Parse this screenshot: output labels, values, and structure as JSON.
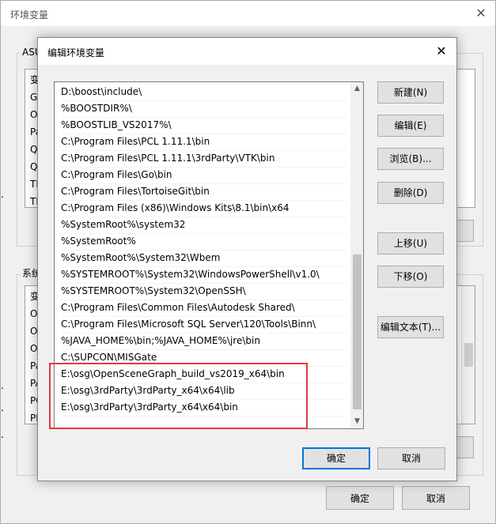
{
  "parent_window": {
    "title": "环境变量",
    "close_glyph": "✕",
    "user_group_label": "ASU",
    "system_group_label": "系统",
    "user_list_rows": [
      "变",
      "G",
      "O",
      "Pa",
      "Q",
      "Q",
      "TE",
      "TM"
    ],
    "system_list_rows": [
      "变",
      "O",
      "O",
      "O",
      "Pa",
      "PA",
      "PC",
      "PF"
    ],
    "ok_label": "确定",
    "cancel_label": "取消",
    "left_edge_fragments": [
      ".",
      ".",
      ".",
      "."
    ]
  },
  "dialog": {
    "title": "编辑环境变量",
    "close_glyph": "✕",
    "path_entries": [
      "D:\\boost\\include\\",
      "%BOOSTDIR%\\",
      "%BOOSTLIB_VS2017%\\",
      "C:\\Program Files\\PCL 1.11.1\\bin",
      "C:\\Program Files\\PCL 1.11.1\\3rdParty\\VTK\\bin",
      "C:\\Program Files\\Go\\bin",
      "C:\\Program Files\\TortoiseGit\\bin",
      "C:\\Program Files (x86)\\Windows Kits\\8.1\\bin\\x64",
      "%SystemRoot%\\system32",
      "%SystemRoot%",
      "%SystemRoot%\\System32\\Wbem",
      "%SYSTEMROOT%\\System32\\WindowsPowerShell\\v1.0\\",
      "%SYSTEMROOT%\\System32\\OpenSSH\\",
      "C:\\Program Files\\Common Files\\Autodesk Shared\\",
      "C:\\Program Files\\Microsoft SQL Server\\120\\Tools\\Binn\\",
      "%JAVA_HOME%\\bin;%JAVA_HOME%\\jre\\bin",
      "C:\\SUPCON\\MISGate",
      "E:\\osg\\OpenSceneGraph_build_vs2019_x64\\bin",
      "E:\\osg\\3rdParty\\3rdParty_x64\\x64\\lib",
      "E:\\osg\\3rdParty\\3rdParty_x64\\x64\\bin",
      ""
    ],
    "buttons": {
      "new": "新建(N)",
      "edit": "编辑(E)",
      "browse": "浏览(B)...",
      "delete": "删除(D)",
      "move_up": "上移(U)",
      "move_down": "下移(O)",
      "edit_text": "编辑文本(T)...",
      "ok": "确定",
      "cancel": "取消"
    },
    "scroll_up_glyph": "▲",
    "scroll_down_glyph": "▼"
  },
  "colors": {
    "highlight_border": "#e03a3e",
    "primary_button_border": "#0078d7"
  }
}
